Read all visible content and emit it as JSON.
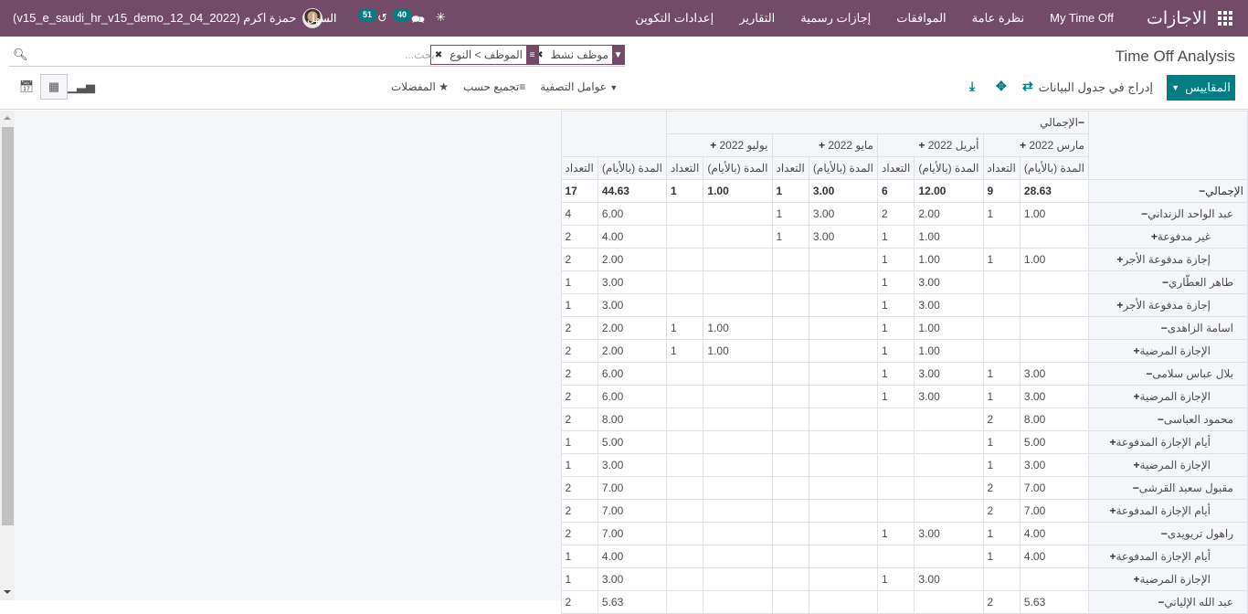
{
  "navbar": {
    "brand": "الاجازات",
    "menu": [
      "My Time Off",
      "نظرة عامة",
      "الموافقات",
      "إجازات رسمية",
      "التقارير",
      "إعدادات التكوين"
    ],
    "company": "السهل",
    "activity_count": "51",
    "messages_count": "40",
    "user": "حمزة اكرم (v15_e_saudi_hr_v15_demo_12_04_2022)"
  },
  "control_panel": {
    "title": "Time Off Analysis",
    "search_placeholder": "بحث...",
    "facets": [
      {
        "icon": "filter-icon",
        "label": "موظف نشط"
      },
      {
        "icon": "groupby-icon",
        "label": "الموظف > النوع"
      }
    ],
    "measures_button": "المقاييس",
    "insert_button": "إدراج في جدول البيانات",
    "filters_label": "عوامل التصفية",
    "groupby_label": "تجميع حسب",
    "favorites_label": "المفضلات"
  },
  "pivot": {
    "col_total_header": "الإجمالي",
    "months": [
      "مارس 2022",
      "أبريل 2022",
      "مايو 2022",
      "يوليو 2022"
    ],
    "measure_duration": "المدة (بالأيام)",
    "measure_count": "التعداد",
    "rows": [
      {
        "label": "الإجمالي",
        "level": 0,
        "sign": "−",
        "cells": [
          "28.63",
          "9",
          "12.00",
          "6",
          "3.00",
          "1",
          "1.00",
          "1",
          "44.63",
          "17"
        ],
        "bold": true
      },
      {
        "label": "عبد الواحد الزنداني",
        "level": 1,
        "sign": "−",
        "cells": [
          "1.00",
          "1",
          "2.00",
          "2",
          "3.00",
          "1",
          "",
          "",
          "6.00",
          "4"
        ]
      },
      {
        "label": "غير مدفوعة",
        "level": 2,
        "sign": "+",
        "cells": [
          "",
          "",
          "1.00",
          "1",
          "3.00",
          "1",
          "",
          "",
          "4.00",
          "2"
        ]
      },
      {
        "label": "إجازة مدفوعة الأجر",
        "level": 2,
        "sign": "+",
        "cells": [
          "1.00",
          "1",
          "1.00",
          "1",
          "",
          "",
          "",
          "",
          "2.00",
          "2"
        ]
      },
      {
        "label": "طاهر العطّاري",
        "level": 1,
        "sign": "−",
        "cells": [
          "",
          "",
          "3.00",
          "1",
          "",
          "",
          "",
          "",
          "3.00",
          "1"
        ]
      },
      {
        "label": "إجازة مدفوعة الأجر",
        "level": 2,
        "sign": "+",
        "cells": [
          "",
          "",
          "3.00",
          "1",
          "",
          "",
          "",
          "",
          "3.00",
          "1"
        ]
      },
      {
        "label": "اسامة الزاهدى",
        "level": 1,
        "sign": "−",
        "cells": [
          "",
          "",
          "1.00",
          "1",
          "",
          "",
          "1.00",
          "1",
          "2.00",
          "2"
        ]
      },
      {
        "label": "الإجازة المرضية",
        "level": 2,
        "sign": "+",
        "cells": [
          "",
          "",
          "1.00",
          "1",
          "",
          "",
          "1.00",
          "1",
          "2.00",
          "2"
        ]
      },
      {
        "label": "بلال عباس سلامى",
        "level": 1,
        "sign": "−",
        "cells": [
          "3.00",
          "1",
          "3.00",
          "1",
          "",
          "",
          "",
          "",
          "6.00",
          "2"
        ]
      },
      {
        "label": "الإجازة المرضية",
        "level": 2,
        "sign": "+",
        "cells": [
          "3.00",
          "1",
          "3.00",
          "1",
          "",
          "",
          "",
          "",
          "6.00",
          "2"
        ]
      },
      {
        "label": "محمود العباسى",
        "level": 1,
        "sign": "−",
        "cells": [
          "8.00",
          "2",
          "",
          "",
          "",
          "",
          "",
          "",
          "8.00",
          "2"
        ]
      },
      {
        "label": "أيام الإجازة المدفوعة",
        "level": 2,
        "sign": "+",
        "cells": [
          "5.00",
          "1",
          "",
          "",
          "",
          "",
          "",
          "",
          "5.00",
          "1"
        ]
      },
      {
        "label": "الإجازة المرضية",
        "level": 2,
        "sign": "+",
        "cells": [
          "3.00",
          "1",
          "",
          "",
          "",
          "",
          "",
          "",
          "3.00",
          "1"
        ]
      },
      {
        "label": "مقبول سعيد القرشى",
        "level": 1,
        "sign": "−",
        "cells": [
          "7.00",
          "2",
          "",
          "",
          "",
          "",
          "",
          "",
          "7.00",
          "2"
        ]
      },
      {
        "label": "أيام الإجازة المدفوعة",
        "level": 2,
        "sign": "+",
        "cells": [
          "7.00",
          "2",
          "",
          "",
          "",
          "",
          "",
          "",
          "7.00",
          "2"
        ]
      },
      {
        "label": "راهول تريويدى",
        "level": 1,
        "sign": "−",
        "cells": [
          "4.00",
          "1",
          "3.00",
          "1",
          "",
          "",
          "",
          "",
          "7.00",
          "2"
        ]
      },
      {
        "label": "أيام الإجازة المدفوعة",
        "level": 2,
        "sign": "+",
        "cells": [
          "4.00",
          "1",
          "",
          "",
          "",
          "",
          "",
          "",
          "4.00",
          "1"
        ]
      },
      {
        "label": "الإجازة المرضية",
        "level": 2,
        "sign": "+",
        "cells": [
          "",
          "",
          "3.00",
          "1",
          "",
          "",
          "",
          "",
          "3.00",
          "1"
        ]
      },
      {
        "label": "عبد الله الإلياني",
        "level": 1,
        "sign": "−",
        "cells": [
          "5.63",
          "2",
          "",
          "",
          "",
          "",
          "",
          "",
          "5.63",
          "2"
        ]
      }
    ]
  }
}
